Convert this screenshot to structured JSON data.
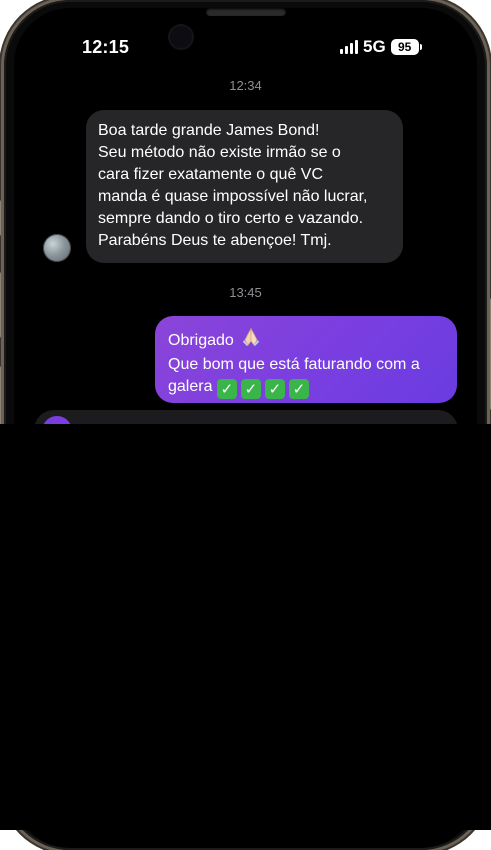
{
  "status_bar": {
    "time": "12:15",
    "network": "5G",
    "battery": "95"
  },
  "chat": {
    "timestamp_1": "12:34",
    "incoming_message": {
      "lines": [
        "Boa tarde grande James Bond!",
        "Seu método não existe irmão se o",
        "cara fizer exatamente o quê VC",
        "manda é quase impossível não lucrar,",
        "sempre dando o tiro certo e vazando.",
        "Parabéns Deus te abençoe! Tmj."
      ]
    },
    "timestamp_2": "13:45",
    "outgoing_message": {
      "line1": "Obrigado",
      "line2": "Que bom que está faturando com a",
      "line3": "galera"
    }
  },
  "colors": {
    "incoming_bubble": "#262628",
    "outgoing_bubble": "#7a3ee0",
    "timestamp": "#8e8e93"
  },
  "icons": [
    "folded-hands-emoji",
    "check-mark-emoji",
    "microphone-icon",
    "camera-icon",
    "sticker-icon"
  ]
}
